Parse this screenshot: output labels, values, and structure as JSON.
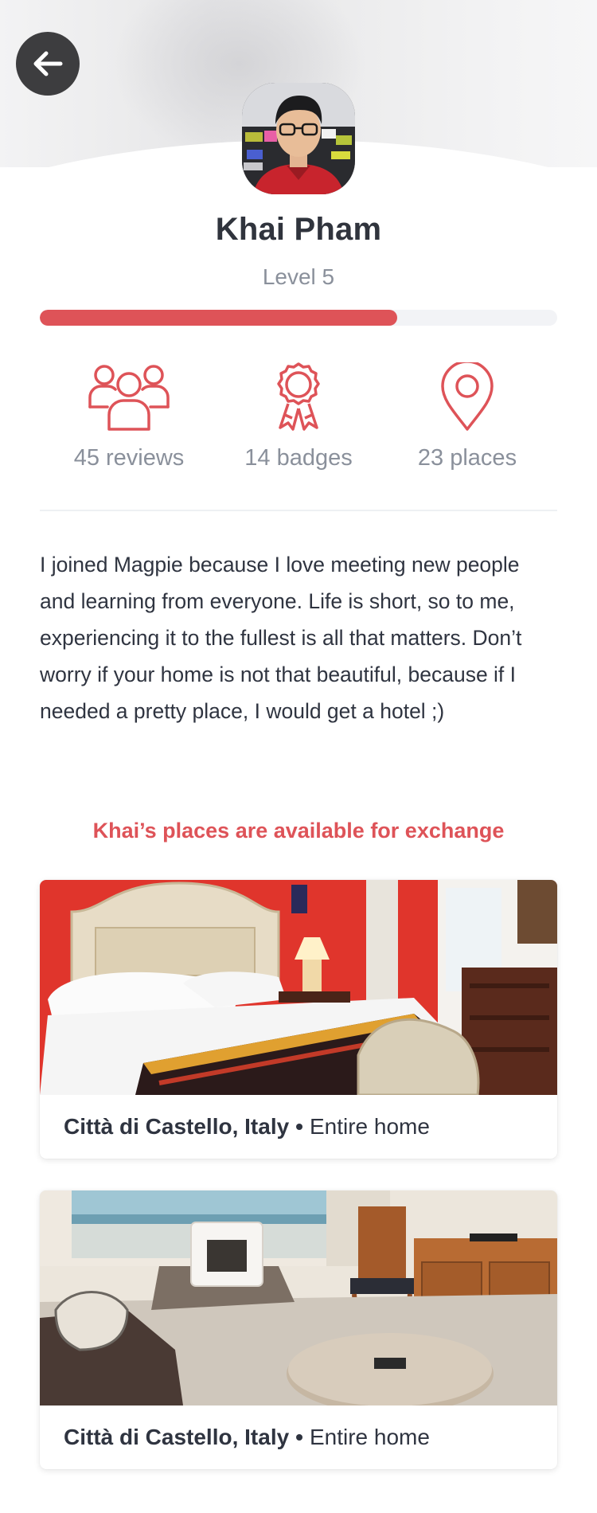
{
  "profile": {
    "name": "Khai Pham",
    "level_label": "Level 5",
    "level_progress": 0.69
  },
  "stats": [
    {
      "icon": "group-icon",
      "label": "45 reviews"
    },
    {
      "icon": "badge-ribbon-icon",
      "label": "14 badges"
    },
    {
      "icon": "map-pin-icon",
      "label": "23 places"
    }
  ],
  "bio": "I joined Magpie because I love meeting new people and learning from everyone. Life is short, so to me, experiencing it to the fullest is all that matters. Don’t worry if your home is not that beautiful, because if I needed a pretty place, I would get a hotel ;)",
  "exchange_note": "Khai’s places are available for exchange",
  "places": [
    {
      "city": "Città di Castello, Italy",
      "separator": "•",
      "type": "Entire home"
    },
    {
      "city": "Città di Castello, Italy",
      "separator": "•",
      "type": "Entire home"
    }
  ],
  "colors": {
    "accent": "#de5358",
    "text_primary": "#2f3440",
    "text_secondary": "#8a909b",
    "back_button_bg": "#3d3d3f"
  }
}
